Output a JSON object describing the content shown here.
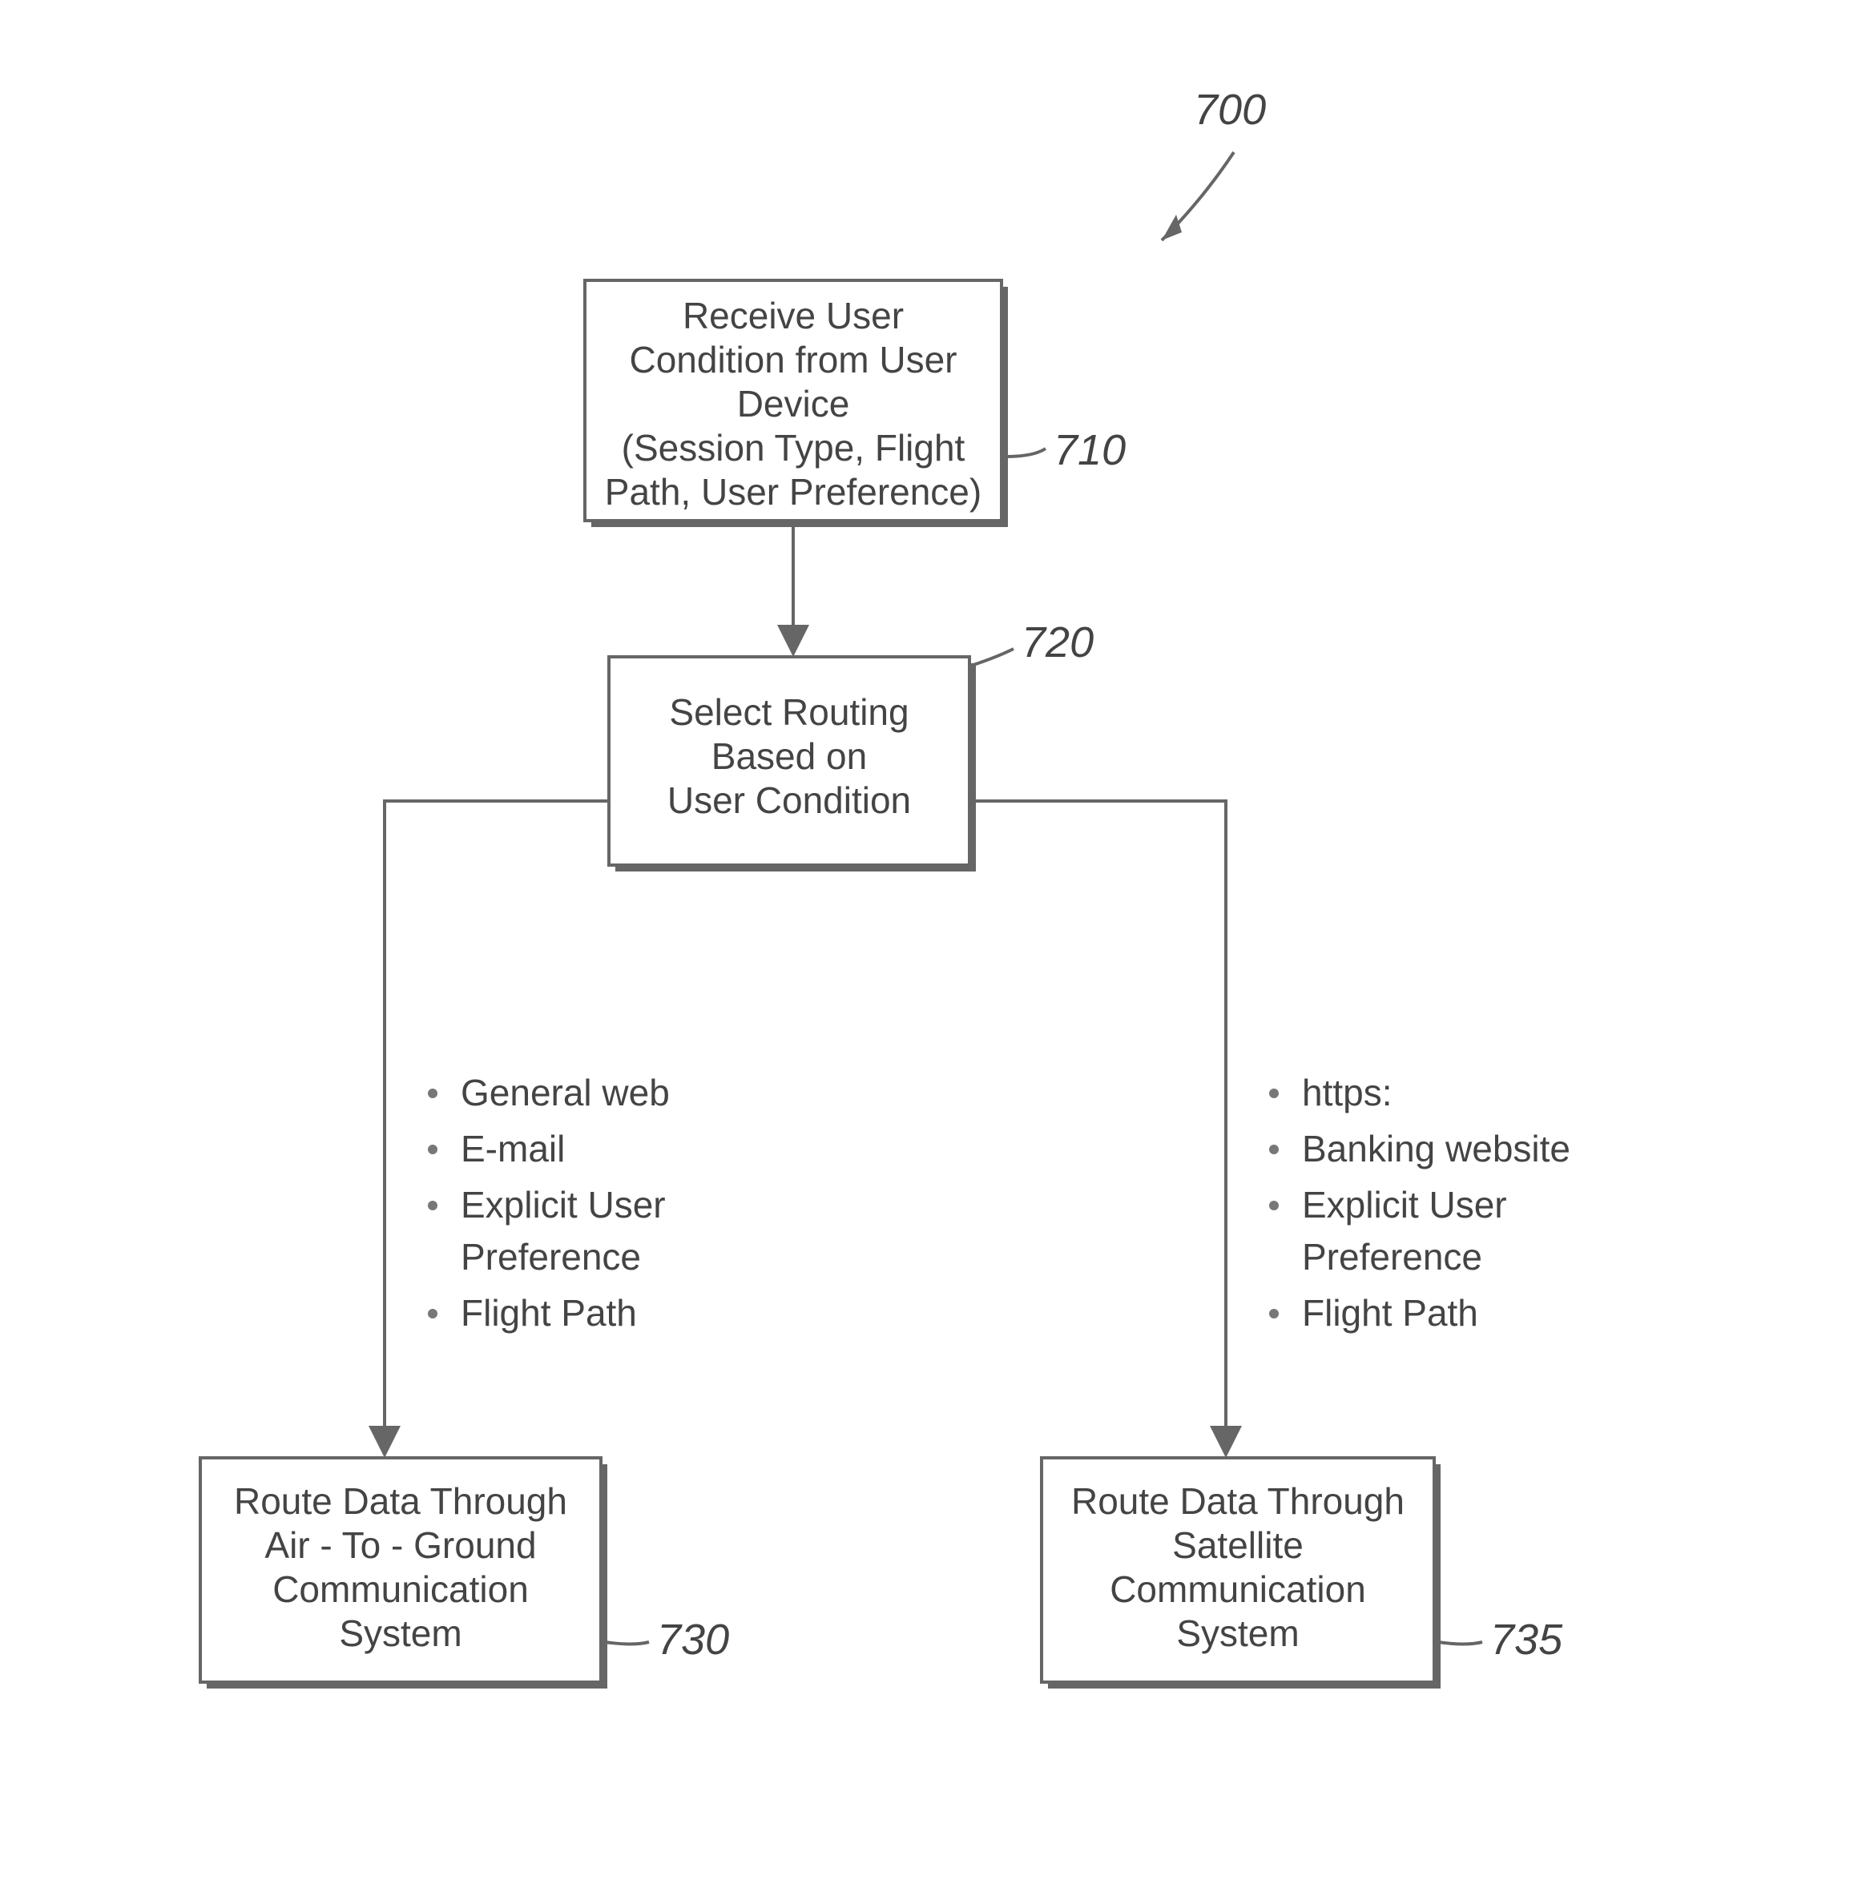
{
  "figure_ref": "700",
  "boxes": {
    "b710": {
      "ref": "710",
      "lines": [
        "Receive User",
        "Condition from User",
        "Device",
        "(Session Type, Flight",
        "Path, User Preference)"
      ]
    },
    "b720": {
      "ref": "720",
      "lines": [
        "Select Routing",
        "Based on",
        "User Condition"
      ]
    },
    "b730": {
      "ref": "730",
      "lines": [
        "Route Data Through",
        "Air - To - Ground",
        "Communication",
        "System"
      ]
    },
    "b735": {
      "ref": "735",
      "lines": [
        "Route Data Through",
        "Satellite",
        "Communication",
        "System"
      ]
    }
  },
  "left_bullets": [
    "General web",
    "E-mail",
    "Explicit User",
    "Preference",
    "Flight Path"
  ],
  "right_bullets": [
    "https:",
    "Banking website",
    "Explicit User",
    "Preference",
    "Flight Path"
  ],
  "chart_data": {
    "type": "flowchart",
    "nodes": [
      {
        "id": "710",
        "label": "Receive User Condition from User Device (Session Type, Flight Path, User Preference)"
      },
      {
        "id": "720",
        "label": "Select Routing Based on User Condition"
      },
      {
        "id": "730",
        "label": "Route Data Through Air-To-Ground Communication System"
      },
      {
        "id": "735",
        "label": "Route Data Through Satellite Communication System"
      }
    ],
    "edges": [
      {
        "from": "700",
        "to": "710",
        "type": "pointer"
      },
      {
        "from": "710",
        "to": "720"
      },
      {
        "from": "720",
        "to": "730",
        "conditions": [
          "General web",
          "E-mail",
          "Explicit User Preference",
          "Flight Path"
        ]
      },
      {
        "from": "720",
        "to": "735",
        "conditions": [
          "https:",
          "Banking website",
          "Explicit User Preference",
          "Flight Path"
        ]
      }
    ]
  }
}
